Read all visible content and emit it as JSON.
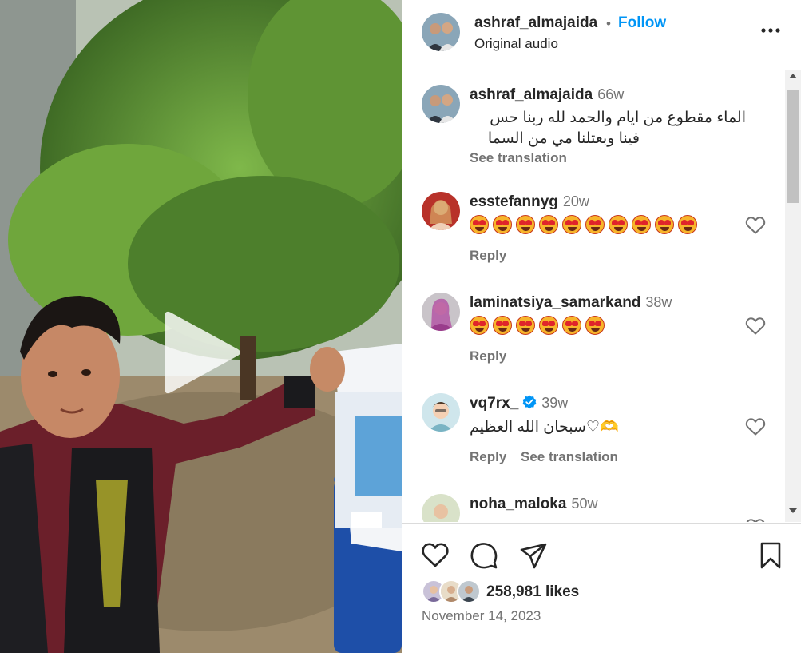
{
  "post": {
    "username": "ashraf_almajaida",
    "separator": "•",
    "follow_label": "Follow",
    "audio_label": "Original audio"
  },
  "caption": {
    "username": "ashraf_almajaida",
    "time": "66w",
    "text_line1": "الماء مقطوع من ايام والحمد لله ربنا حس",
    "text_line2": "فينا وبعتلنا مي من السما",
    "see_translation": "See translation"
  },
  "comments": [
    {
      "username": "esstefannyg",
      "time": "20w",
      "emoji_count": 10,
      "reply_label": "Reply"
    },
    {
      "username": "laminatsiya_samarkand",
      "time": "38w",
      "emoji_count": 6,
      "reply_label": "Reply"
    },
    {
      "username": "vq7rx_",
      "verified": true,
      "time": "39w",
      "text": "سبحان الله العظيم♡🫶",
      "reply_label": "Reply",
      "see_translation": "See translation"
    },
    {
      "username": "noha_maloka",
      "time": "50w"
    }
  ],
  "footer": {
    "likes": "258,981 likes",
    "date": "November 14, 2023"
  },
  "icons": {
    "more": "more-horizontal-icon",
    "like": "heart-icon",
    "comment": "comment-icon",
    "share": "share-icon",
    "save": "bookmark-icon",
    "play": "play-icon",
    "verified": "verified-badge-icon"
  },
  "colors": {
    "link_blue": "#0095f6",
    "muted_text": "#737373",
    "primary_text": "#262626",
    "divider": "#dbdbdb"
  }
}
